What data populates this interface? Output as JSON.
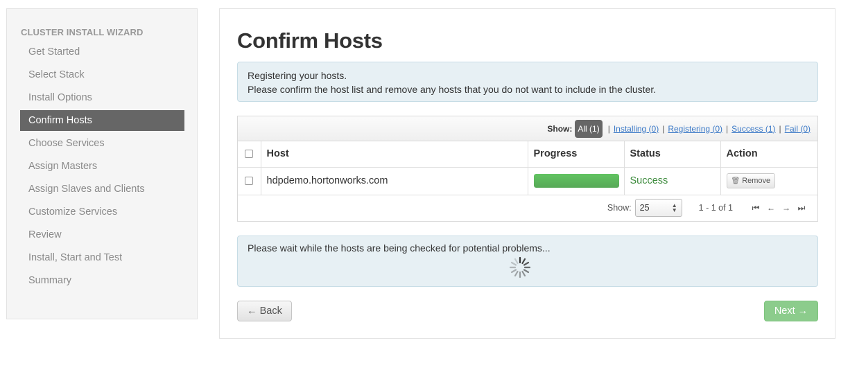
{
  "sidebar": {
    "header": "CLUSTER INSTALL WIZARD",
    "items": [
      {
        "label": "Get Started"
      },
      {
        "label": "Select Stack"
      },
      {
        "label": "Install Options"
      },
      {
        "label": "Confirm Hosts"
      },
      {
        "label": "Choose Services"
      },
      {
        "label": "Assign Masters"
      },
      {
        "label": "Assign Slaves and Clients"
      },
      {
        "label": "Customize Services"
      },
      {
        "label": "Review"
      },
      {
        "label": "Install, Start and Test"
      },
      {
        "label": "Summary"
      }
    ],
    "active_item": "Confirm Hosts"
  },
  "main": {
    "title": "Confirm Hosts",
    "info_line1": "Registering your hosts.",
    "info_line2": "Please confirm the host list and remove any hosts that you do not want to include in the cluster.",
    "filter": {
      "label": "Show:",
      "all": "All (1)",
      "installing": "Installing (0)",
      "registering": "Registering (0)",
      "success": "Success (1)",
      "fail": "Fail (0)",
      "separator": "|"
    },
    "table": {
      "columns": [
        "Host",
        "Progress",
        "Status",
        "Action"
      ],
      "rows": [
        {
          "host": "hdpdemo.hortonworks.com",
          "progress": 1.0,
          "status": "Success",
          "action": "Remove"
        }
      ]
    },
    "pager": {
      "show_label": "Show:",
      "page_size": "25",
      "range": "1 - 1 of 1"
    },
    "checking_message": "Please wait while the hosts are being checked for potential problems...",
    "back_label": "← Back",
    "next_label": "Next →"
  },
  "colors": {
    "active_nav": "#666666",
    "info_bg": "#e7f0f4",
    "success_text": "#3b8a3b",
    "progress_fill": "#5cb85c",
    "next_button": "#8ccc8c"
  }
}
